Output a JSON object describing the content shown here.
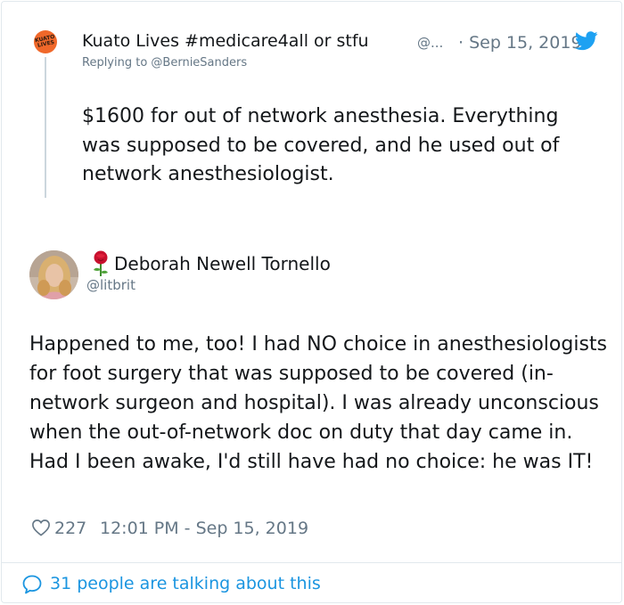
{
  "parent_tweet": {
    "avatar_text": "KUATO LIVES",
    "display_name": "Kuato Lives #medicare4all or stfu",
    "handle": "@...",
    "date": "· Sep 15, 2019",
    "replying_to": "Replying to @BernieSanders",
    "text": "$1600 for out of network anesthesia. Everything was supposed to be covered, and he used out of network anesthesiologist.",
    "icons": [
      "twitter-bird-icon"
    ],
    "colors": {
      "avatar_bg": "#f0682a",
      "twitter_blue": "#1da1f2"
    }
  },
  "reply_tweet": {
    "display_name": "Deborah Newell Tornello",
    "handle": "@litbrit",
    "text": "Happened to me, too! I had NO choice in anesthesiologists for foot surgery that was supposed to be covered (in-network surgeon and hospital). I was already unconscious when the out-of-network doc on duty that day came in. Had I been awake, I'd still have had no choice: he was IT!",
    "likes": "227",
    "timestamp": "12:01 PM - Sep 15, 2019",
    "icons": [
      "rose-icon",
      "heart-icon"
    ]
  },
  "footer": {
    "talking_text": "31 people are talking about this",
    "icon": "speech-bubble-icon",
    "link_color": "#1b95e0"
  }
}
